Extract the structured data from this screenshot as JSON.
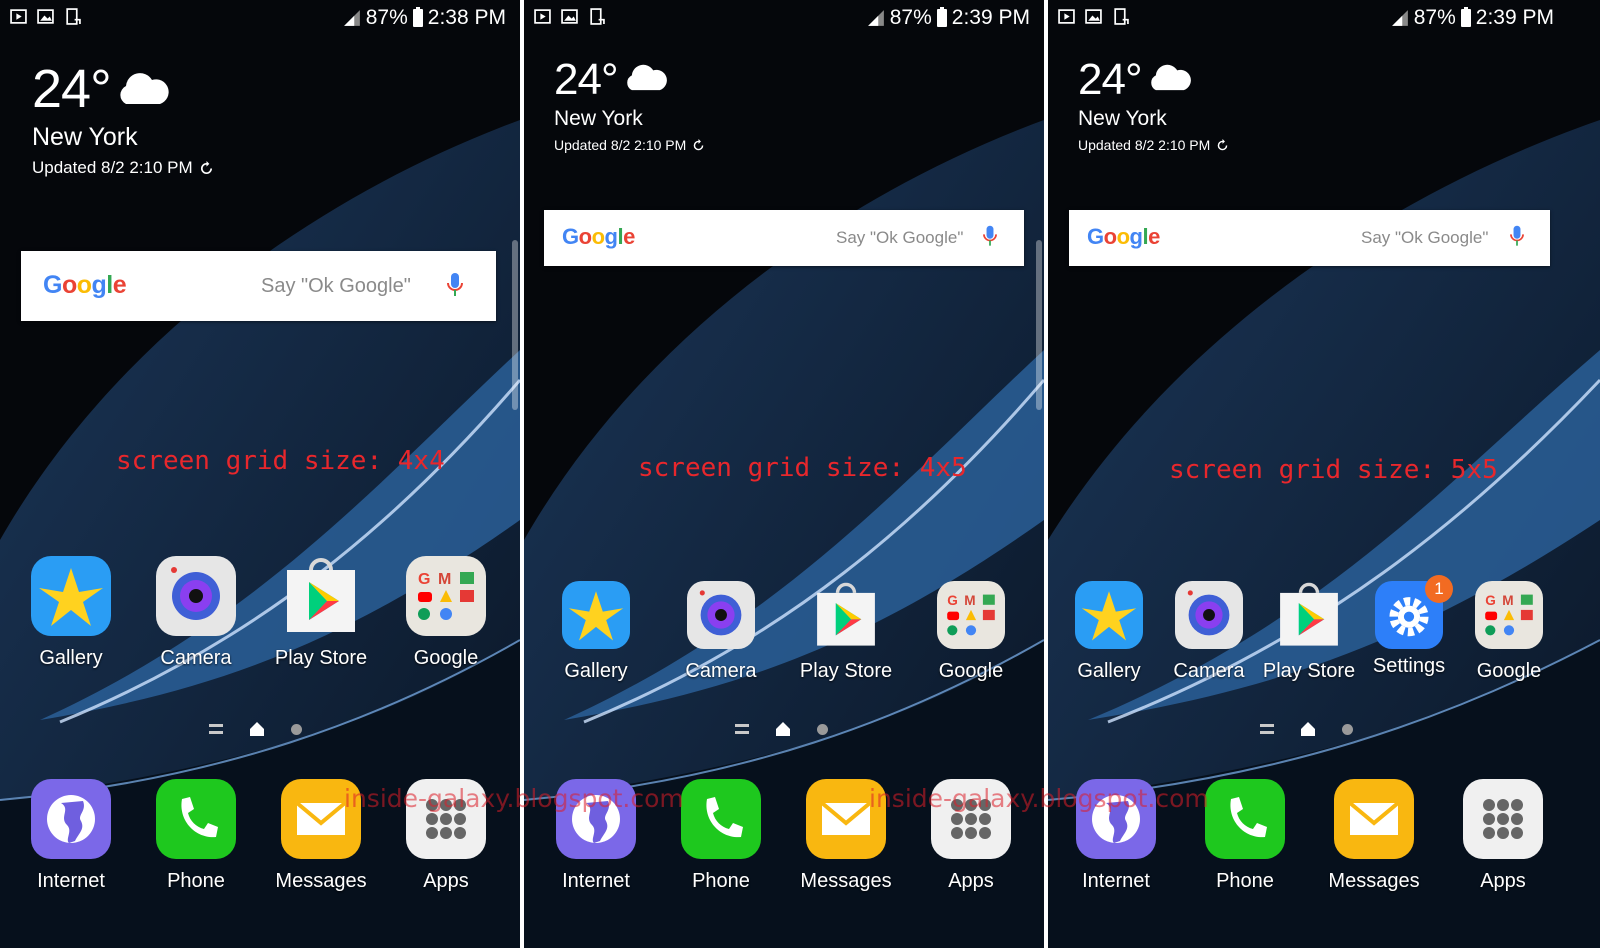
{
  "status": {
    "battery": "87%",
    "times": [
      "2:38 PM",
      "2:39 PM",
      "2:39 PM"
    ]
  },
  "weather": {
    "temp": "24°",
    "city": "New York",
    "updated": "Updated 8/2 2:10 PM"
  },
  "search": {
    "logo": "Google",
    "placeholder": "Say \"Ok Google\""
  },
  "grid_labels": [
    "screen grid size: 4x4",
    "screen grid size: 4x5",
    "screen grid size: 5x5"
  ],
  "apps": {
    "gallery": "Gallery",
    "camera": "Camera",
    "play_store": "Play Store",
    "settings": "Settings",
    "google": "Google",
    "internet": "Internet",
    "phone": "Phone",
    "messages": "Messages",
    "apps": "Apps"
  },
  "settings_badge": "1",
  "watermark": "inside-galaxy.blogspot.com",
  "icons": [
    "gallery-icon",
    "camera-icon",
    "play-store-icon",
    "settings-icon",
    "google-folder-icon",
    "internet-icon",
    "phone-icon",
    "messages-icon",
    "apps-icon",
    "mic-icon",
    "cloud-icon",
    "refresh-icon"
  ],
  "colors": {
    "grid_label": "#e8272c",
    "background": "#05070b"
  }
}
